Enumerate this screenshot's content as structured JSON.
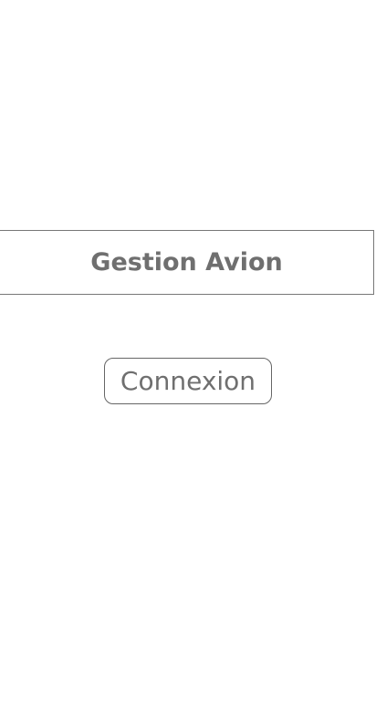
{
  "header": {
    "title": "Gestion Avion"
  },
  "actions": {
    "login_label": "Connexion"
  },
  "colors": {
    "text": "#6f6f6f",
    "border": "#777777",
    "background": "#ffffff"
  }
}
